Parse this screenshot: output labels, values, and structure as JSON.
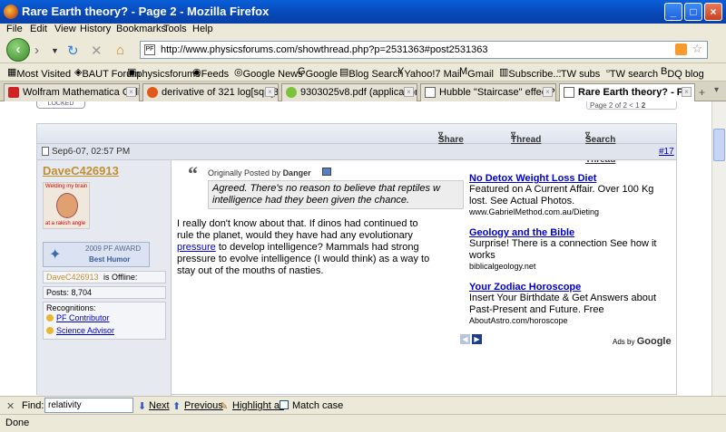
{
  "window": {
    "title": "Rare Earth theory? - Page 2 - Mozilla Firefox"
  },
  "menu": [
    "File",
    "Edit",
    "View",
    "History",
    "Bookmarks",
    "Tools",
    "Help"
  ],
  "address": {
    "url": "http://www.physicsforums.com/showthread.php?p=2531363#post2531363",
    "favicon_label": "PF"
  },
  "bookmarks": [
    "Most Visited",
    "BAUT Forum",
    "physicsforums",
    "Feeds",
    "Google News",
    "Google",
    "Blog Search",
    "Yahoo!7 Mail",
    "Gmail",
    "Subscribe...",
    "TW subs",
    "TW search",
    "DQ blog"
  ],
  "tabs": [
    {
      "label": "Wolfram Mathematica Onlin..."
    },
    {
      "label": "derivative of 321 log[sqrt[3..."
    },
    {
      "label": "9303025v8.pdf (application..."
    },
    {
      "label": "Hubble \"Staircase\" effect?"
    },
    {
      "label": "Rare Earth theory? - P..."
    }
  ],
  "page": {
    "locked_label": "LOCKED",
    "pager": {
      "label": "Page 2 of 2",
      "prev": "<",
      "p1": "1",
      "p2": "2"
    },
    "thread_tools": {
      "share": "Share It",
      "tools": "Thread Tools",
      "search": "Search this Thread"
    },
    "post_date": "Sep6-07, 02:57 PM",
    "post_number": "#17",
    "user": {
      "name": "DaveC426913",
      "award_year": "2009 PF AWARD",
      "award_name": "Best Humor",
      "status_name": "DaveC426913",
      "status_text": "is Offline:",
      "posts": "Posts: 8,704",
      "recognitions_label": "Recognitions:",
      "recog1": "PF Contributor",
      "recog2": "Science Advisor",
      "avatar_top": "Welding my brain",
      "avatar_bottom": "at a rakish angle"
    },
    "quote": {
      "prefix": "Originally Posted by",
      "author": "Danger",
      "text": "Agreed. There's no reason to believe that reptiles w intelligence had they been given the chance."
    },
    "body_lines": [
      "I really don't know about that. If dinos had continued to",
      "rule the planet, would they have had any evolutionary",
      "to develop intelligence? Mammals had strong",
      "pressure to evolve intelligence (I would think) as a way to",
      "stay out of the mouths of nasties."
    ],
    "body_link": "pressure",
    "ads": [
      {
        "title": "No Detox Weight Loss Diet",
        "text": "Featured on A Current Affair. Over 100 Kg lost. See Actual Photos.",
        "url": "www.GabrielMethod.com.au/Dieting"
      },
      {
        "title": "Geology and the Bible",
        "text": "Surprise! There is a connection See how it works",
        "url": "biblicalgeology.net"
      },
      {
        "title": "Your Zodiac Horoscope",
        "text": "Insert Your Birthdate & Get Answers about Past-Present and Future. Free",
        "url": "AboutAstro.com/horoscope"
      }
    ],
    "ads_by": "Ads by",
    "ads_brand": "Google"
  },
  "findbar": {
    "label": "Find:",
    "value": "relativity",
    "next": "Next",
    "previous": "Previous",
    "highlight": "Highlight all",
    "matchcase": "Match case"
  },
  "status": "Done"
}
